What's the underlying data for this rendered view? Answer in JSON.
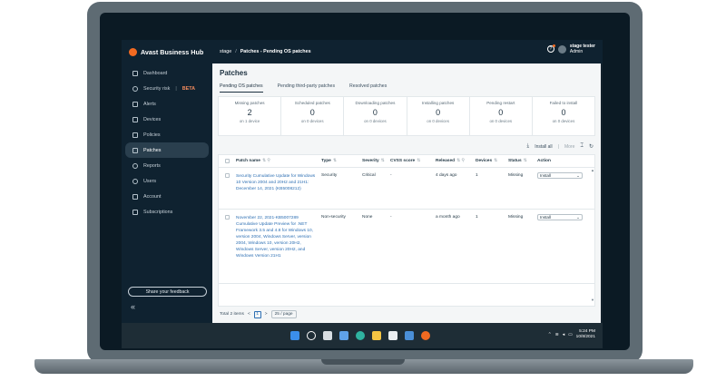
{
  "app": {
    "name": "Avast Business Hub"
  },
  "breadcrumb": {
    "root": "stage",
    "separator": "/",
    "current": "Patches - Pending OS patches"
  },
  "user": {
    "name": "stage tester",
    "role": "Admin"
  },
  "sidebar": {
    "items": [
      {
        "label": "Dashboard",
        "icon": "home-icon"
      },
      {
        "label": "Security risk",
        "icon": "shield-icon",
        "badge_sep": "|",
        "badge": "BETA"
      },
      {
        "label": "Alerts",
        "icon": "bell-icon"
      },
      {
        "label": "Devices",
        "icon": "monitor-icon"
      },
      {
        "label": "Policies",
        "icon": "policy-icon"
      },
      {
        "label": "Patches",
        "icon": "grid-icon",
        "active": true
      },
      {
        "label": "Reports",
        "icon": "reports-icon"
      },
      {
        "label": "Users",
        "icon": "users-icon"
      },
      {
        "label": "Account",
        "icon": "account-icon"
      },
      {
        "label": "Subscriptions",
        "icon": "subscriptions-icon"
      }
    ],
    "feedback_label": "Share your feedback",
    "collapse_glyph": "«"
  },
  "page": {
    "title": "Patches"
  },
  "tabs": [
    {
      "label": "Pending OS patches",
      "active": true
    },
    {
      "label": "Pending third-party patches"
    },
    {
      "label": "Resolved patches"
    }
  ],
  "stats": [
    {
      "label": "Missing patches",
      "value": "2",
      "sub": "on 1 device"
    },
    {
      "label": "Scheduled patches",
      "value": "0",
      "sub": "on 0 devices"
    },
    {
      "label": "Downloading patches",
      "value": "0",
      "sub": "on 0 devices"
    },
    {
      "label": "Installing patches",
      "value": "0",
      "sub": "on 0 devices"
    },
    {
      "label": "Pending restart",
      "value": "0",
      "sub": "on 0 devices"
    },
    {
      "label": "Failed to install",
      "value": "0",
      "sub": "on 0 devices"
    }
  ],
  "toolbar": {
    "install_all": "Install all",
    "more": "More",
    "separator": "|"
  },
  "table": {
    "headers": {
      "name": "Patch name",
      "type": "Type",
      "severity": "Severity",
      "cvss": "CVSS score",
      "released": "Released",
      "devices": "Devices",
      "status": "Status",
      "action": "Action"
    },
    "rows": [
      {
        "name": "Security Cumulative Update for Windows 10 Version 2004 and 20H2 and 21H1: December 14, 2021 (KB5008212)",
        "type": "Security",
        "severity": "Critical",
        "cvss": "-",
        "released": "4 days ago",
        "devices": "1",
        "status": "Missing",
        "action": "Install"
      },
      {
        "name": "November 22, 2021-KB5007289 Cumulative Update Preview for .NET Framework 3.5 and 4.8 for Windows 10, version 2004, Windows Server, version 2004, Windows 10, version 20H2, Windows Server, version 20H2, and Windows Version 21H1",
        "type": "Non-security",
        "severity": "None",
        "cvss": "-",
        "released": "a month ago",
        "devices": "1",
        "status": "Missing",
        "action": "Install"
      }
    ]
  },
  "pager": {
    "total": "Total 2 items",
    "prev": "<",
    "page": "1",
    "next": ">",
    "per_page": "25 / page"
  },
  "taskbar": {
    "time": "5:24 PM",
    "date": "10/8/2021"
  }
}
